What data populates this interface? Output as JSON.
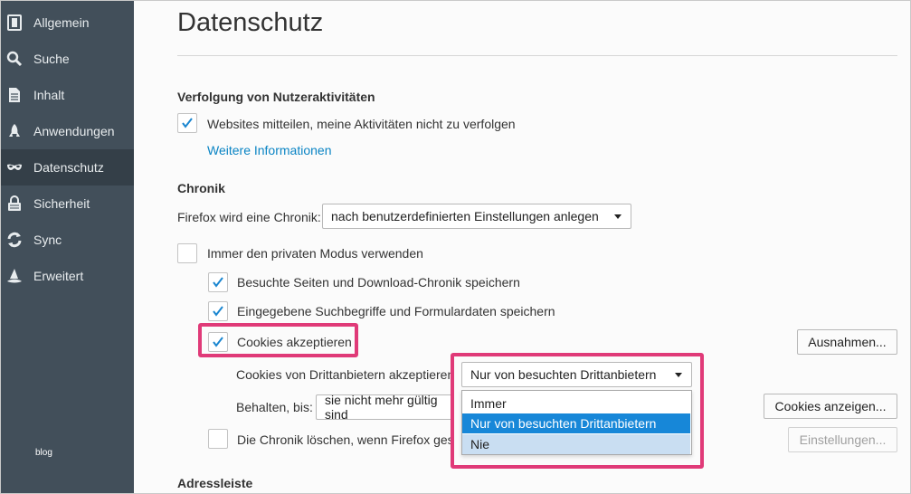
{
  "sidebar": {
    "items": [
      {
        "label": "Allgemein",
        "icon": "general-icon"
      },
      {
        "label": "Suche",
        "icon": "search-icon"
      },
      {
        "label": "Inhalt",
        "icon": "document-icon"
      },
      {
        "label": "Anwendungen",
        "icon": "rocket-icon"
      },
      {
        "label": "Datenschutz",
        "icon": "mask-icon",
        "active": true
      },
      {
        "label": "Sicherheit",
        "icon": "lock-icon"
      },
      {
        "label": "Sync",
        "icon": "sync-icon"
      },
      {
        "label": "Erweitert",
        "icon": "wizard-hat-icon"
      }
    ],
    "blog_label": "blog"
  },
  "main": {
    "title": "Datenschutz",
    "tracking": {
      "heading": "Verfolgung von Nutzeraktivitäten",
      "dnt_label": "Websites mitteilen, meine Aktivitäten nicht zu verfolgen",
      "dnt_checked": true,
      "more_info_link": "Weitere Informationen"
    },
    "history": {
      "heading": "Chronik",
      "firefox_will_label": "Firefox wird eine Chronik:",
      "history_mode_value": "nach benutzerdefinierten Einstellungen anlegen",
      "private_mode_label": "Immer den privaten Modus verwenden",
      "private_mode_checked": false,
      "browse_history_label": "Besuchte Seiten und Download-Chronik speichern",
      "browse_history_checked": true,
      "form_history_label": "Eingegebene Suchbegriffe und Formulardaten speichern",
      "form_history_checked": true,
      "cookies_label": "Cookies akzeptieren",
      "cookies_checked": true,
      "exceptions_button": "Ausnahmen...",
      "third_party_label": "Cookies von Drittanbietern akzeptieren:",
      "third_party_value": "Nur von besuchten Drittanbietern",
      "third_party_options": [
        "Immer",
        "Nur von besuchten Drittanbietern",
        "Nie"
      ],
      "keep_until_label": "Behalten, bis:",
      "keep_until_value": "sie nicht mehr gültig sind",
      "show_cookies_button": "Cookies anzeigen...",
      "clear_on_close_label": "Die Chronik löschen, wenn Firefox geschlossen wird",
      "clear_on_close_checked": false,
      "settings_button": "Einstellungen..."
    },
    "location_bar": {
      "heading": "Adressleiste"
    }
  },
  "colors": {
    "sidebar_bg": "#424f5a",
    "sidebar_active": "#343f48",
    "accent_link": "#0a84c4",
    "highlight": "#e03a78",
    "selected_option": "#1787d8"
  }
}
